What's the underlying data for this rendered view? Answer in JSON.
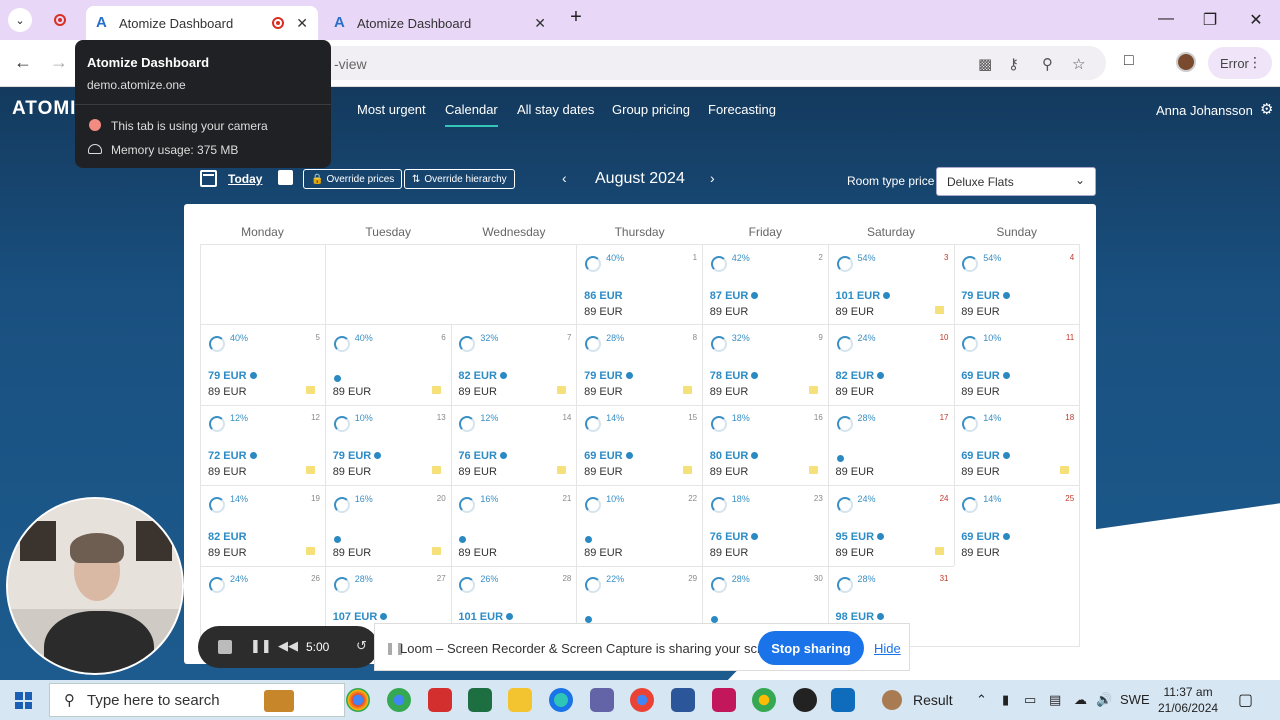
{
  "browser": {
    "tabs": [
      {
        "title": "Atomize Dashboard"
      },
      {
        "title": "Atomize Dashboard"
      }
    ],
    "new_tab_label": "+",
    "url_partial": "-view",
    "error_label": "Error",
    "tooltip": {
      "title": "Atomize Dashboard",
      "domain": "demo.atomize.one",
      "camera_text": "This tab is using your camera",
      "memory_text": "Memory usage: 375 MB"
    }
  },
  "app": {
    "logo": "ATOMIZ",
    "nav": [
      "Most urgent",
      "Calendar",
      "All stay dates",
      "Group pricing",
      "Forecasting"
    ],
    "active_nav": "Calendar",
    "user": "Anna Johansson",
    "today_label": "Today",
    "override_prices_label": "Override prices",
    "override_hierarchy_label": "Override hierarchy",
    "month": "August 2024",
    "room_type_label": "Room type price",
    "room_type_value": "Deluxe Flats"
  },
  "calendar": {
    "weekdays": [
      "Monday",
      "Tuesday",
      "Wednesday",
      "Thursday",
      "Friday",
      "Saturday",
      "Sunday"
    ],
    "weeks": [
      [
        {
          "empty": true
        },
        {
          "empty": true
        },
        {
          "empty": true
        },
        {
          "day": "1",
          "pct": "40%",
          "price": "86 EUR",
          "dot": false,
          "base": "89 EUR",
          "note": false
        },
        {
          "day": "2",
          "pct": "42%",
          "price": "87 EUR",
          "dot": true,
          "base": "89 EUR",
          "note": false
        },
        {
          "day": "3",
          "pct": "54%",
          "price": "101 EUR",
          "dot": true,
          "base": "89 EUR",
          "note": true,
          "weekend": true
        },
        {
          "day": "4",
          "pct": "54%",
          "price": "79 EUR",
          "dot": true,
          "base": "89 EUR",
          "note": false,
          "weekend": true
        }
      ],
      [
        {
          "day": "5",
          "pct": "40%",
          "price": "79 EUR",
          "dot": true,
          "base": "89 EUR",
          "note": true
        },
        {
          "day": "6",
          "pct": "40%",
          "price": "",
          "dot": true,
          "base": "89 EUR",
          "note": true
        },
        {
          "day": "7",
          "pct": "32%",
          "price": "82 EUR",
          "dot": true,
          "base": "89 EUR",
          "note": true
        },
        {
          "day": "8",
          "pct": "28%",
          "price": "79 EUR",
          "dot": true,
          "base": "89 EUR",
          "note": true
        },
        {
          "day": "9",
          "pct": "32%",
          "price": "78 EUR",
          "dot": true,
          "base": "89 EUR",
          "note": true
        },
        {
          "day": "10",
          "pct": "24%",
          "price": "82 EUR",
          "dot": true,
          "base": "89 EUR",
          "note": false,
          "weekend": true
        },
        {
          "day": "11",
          "pct": "10%",
          "price": "69 EUR",
          "dot": true,
          "base": "89 EUR",
          "note": false,
          "weekend": true
        }
      ],
      [
        {
          "day": "12",
          "pct": "12%",
          "price": "72 EUR",
          "dot": true,
          "base": "89 EUR",
          "note": true
        },
        {
          "day": "13",
          "pct": "10%",
          "price": "79 EUR",
          "dot": true,
          "base": "89 EUR",
          "note": true
        },
        {
          "day": "14",
          "pct": "12%",
          "price": "76 EUR",
          "dot": true,
          "base": "89 EUR",
          "note": true
        },
        {
          "day": "15",
          "pct": "14%",
          "price": "69 EUR",
          "dot": true,
          "base": "89 EUR",
          "note": true
        },
        {
          "day": "16",
          "pct": "18%",
          "price": "80 EUR",
          "dot": true,
          "base": "89 EUR",
          "note": true
        },
        {
          "day": "17",
          "pct": "28%",
          "price": "",
          "dot": true,
          "base": "89 EUR",
          "note": false,
          "weekend": true
        },
        {
          "day": "18",
          "pct": "14%",
          "price": "69 EUR",
          "dot": true,
          "base": "89 EUR",
          "note": true,
          "weekend": true
        }
      ],
      [
        {
          "day": "19",
          "pct": "14%",
          "price": "82 EUR",
          "dot": false,
          "base": "89 EUR",
          "note": true
        },
        {
          "day": "20",
          "pct": "16%",
          "price": "",
          "dot": true,
          "base": "89 EUR",
          "note": true
        },
        {
          "day": "21",
          "pct": "16%",
          "price": "",
          "dot": true,
          "base": "89 EUR",
          "note": false
        },
        {
          "day": "22",
          "pct": "10%",
          "price": "",
          "dot": true,
          "base": "89 EUR",
          "note": false
        },
        {
          "day": "23",
          "pct": "18%",
          "price": "76 EUR",
          "dot": true,
          "base": "89 EUR",
          "note": false
        },
        {
          "day": "24",
          "pct": "24%",
          "price": "95 EUR",
          "dot": true,
          "base": "89 EUR",
          "note": true,
          "weekend": true
        },
        {
          "day": "25",
          "pct": "14%",
          "price": "69 EUR",
          "dot": true,
          "base": "89 EUR",
          "note": false,
          "weekend": true
        }
      ],
      [
        {
          "day": "26",
          "pct": "24%",
          "price": "",
          "dot": false,
          "base": "",
          "note": false
        },
        {
          "day": "27",
          "pct": "28%",
          "price": "107 EUR",
          "dot": true,
          "base": "",
          "note": false
        },
        {
          "day": "28",
          "pct": "26%",
          "price": "101 EUR",
          "dot": true,
          "base": "",
          "note": false
        },
        {
          "day": "29",
          "pct": "22%",
          "price": "",
          "dot": true,
          "base": "",
          "note": false
        },
        {
          "day": "30",
          "pct": "28%",
          "price": "",
          "dot": true,
          "base": "",
          "note": false
        },
        {
          "day": "31",
          "pct": "28%",
          "price": "98 EUR",
          "dot": true,
          "base": "",
          "note": false,
          "weekend": true
        },
        {
          "empty": true
        }
      ]
    ]
  },
  "loom": {
    "timer": "5:00",
    "message": "Loom – Screen Recorder & Screen Capture is sharing your screen.",
    "stop_label": "Stop sharing",
    "hide_label": "Hide"
  },
  "taskbar": {
    "search_placeholder": "Type here to search",
    "result_label": "Result",
    "language": "SWE",
    "time": "11:37 am",
    "date": "21/06/2024"
  }
}
